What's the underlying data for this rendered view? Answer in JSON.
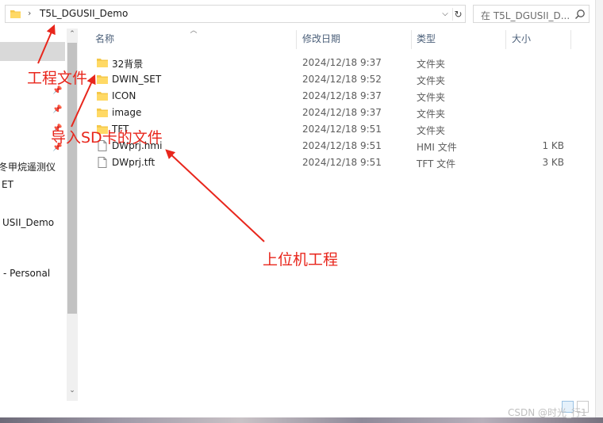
{
  "address": {
    "path": "T5L_DGUSII_Demo",
    "separator": "›",
    "dropdown_glyph": "⌵",
    "refresh_glyph": "↻"
  },
  "search": {
    "placeholder": "在 T5L_DGUSII_D..."
  },
  "nav": {
    "items": [
      {
        "label": "冬甲烷遥测仪"
      },
      {
        "label": "ET"
      },
      {
        "label": "USII_Demo"
      },
      {
        "label": "- Personal"
      }
    ],
    "scroll_up": "⌃",
    "scroll_down": "⌄"
  },
  "columns": {
    "name": "名称",
    "modified": "修改日期",
    "type": "类型",
    "size": "大小"
  },
  "files": [
    {
      "name": "32背景",
      "date": "2024/12/18 9:37",
      "type": "文件夹",
      "size": "",
      "icon": "folder-icon"
    },
    {
      "name": "DWIN_SET",
      "date": "2024/12/18 9:52",
      "type": "文件夹",
      "size": "",
      "icon": "folder-icon"
    },
    {
      "name": "ICON",
      "date": "2024/12/18 9:37",
      "type": "文件夹",
      "size": "",
      "icon": "folder-icon"
    },
    {
      "name": "image",
      "date": "2024/12/18 9:37",
      "type": "文件夹",
      "size": "",
      "icon": "folder-icon"
    },
    {
      "name": "TFT",
      "date": "2024/12/18 9:51",
      "type": "文件夹",
      "size": "",
      "icon": "folder-icon"
    },
    {
      "name": "DWprj.hmi",
      "date": "2024/12/18 9:51",
      "type": "HMI 文件",
      "size": "1 KB",
      "icon": "file-icon"
    },
    {
      "name": "DWprj.tft",
      "date": "2024/12/18 9:51",
      "type": "TFT 文件",
      "size": "3 KB",
      "icon": "file-icon"
    }
  ],
  "annotations": {
    "project_file": "工程文件",
    "import_sd": "导入SD卡的文件",
    "host_project": "上位机工程",
    "color": "#e8261c"
  },
  "watermark": "CSDN @时光_行1"
}
